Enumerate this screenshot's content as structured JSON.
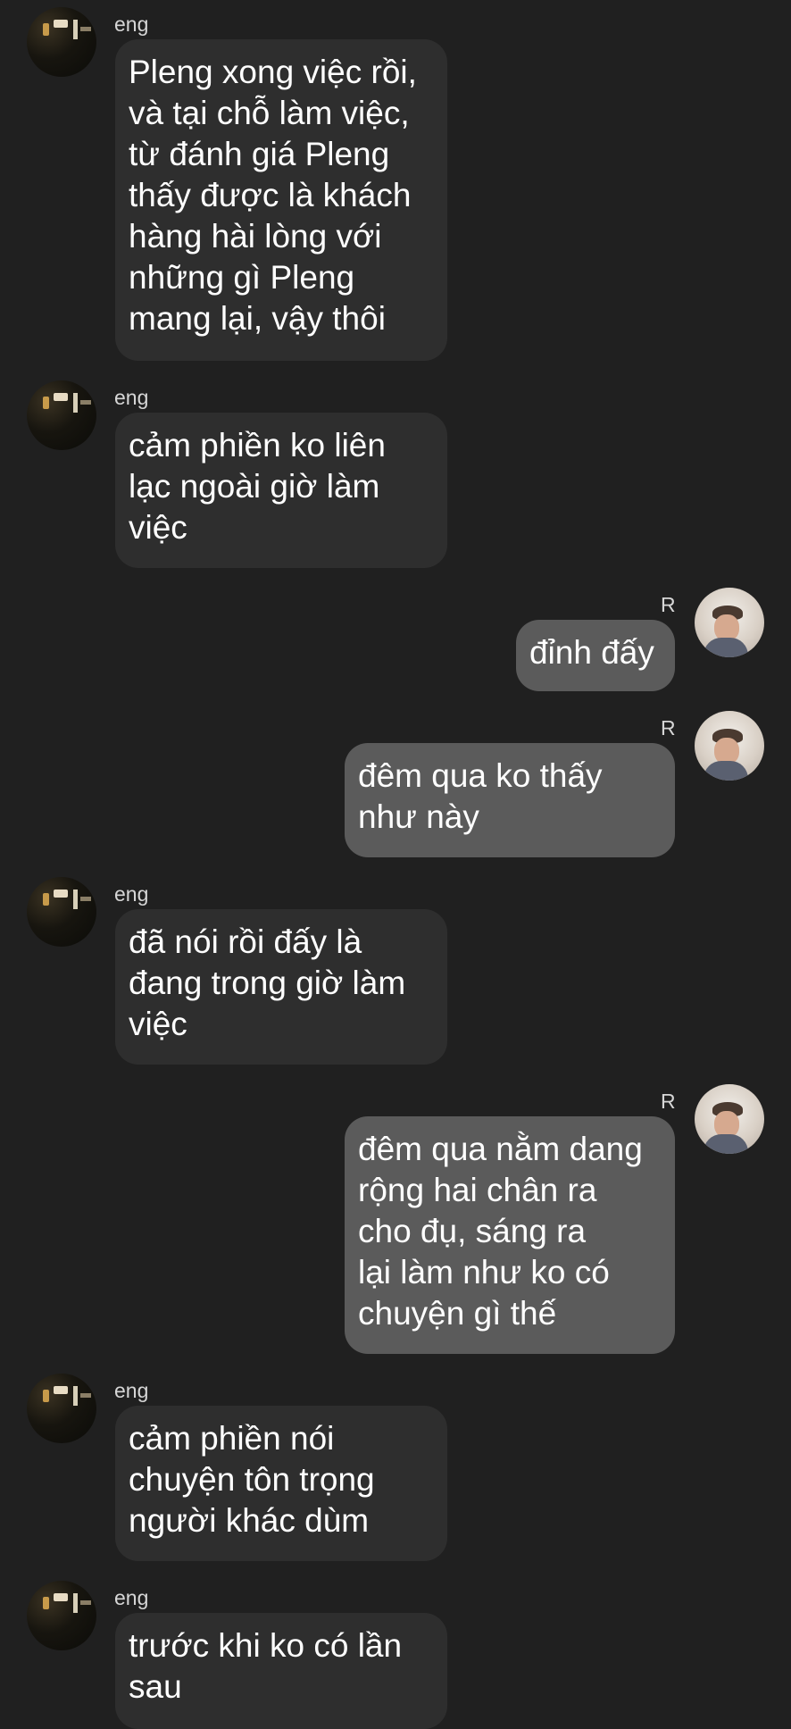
{
  "messages": [
    {
      "sender": "eng",
      "direction": "in",
      "text": "Pleng xong việc rồi,\nvà tại chỗ làm việc,\ntừ đánh giá Pleng\nthấy được là khách\nhàng hài lòng với\nnhững gì Pleng\nmang lại, vậy thôi"
    },
    {
      "sender": "eng",
      "direction": "in",
      "text": "cảm phiền ko liên\nlạc ngoài giờ làm\nviệc"
    },
    {
      "sender": "R",
      "direction": "out",
      "text": "đỉnh đấy"
    },
    {
      "sender": "R",
      "direction": "out",
      "text": "đêm qua ko thấy\nnhư này"
    },
    {
      "sender": "eng",
      "direction": "in",
      "text": "đã nói rồi đấy là\nđang trong giờ làm\nviệc"
    },
    {
      "sender": "R",
      "direction": "out",
      "text": "đêm qua nằm dang\nrộng hai chân ra\ncho đụ, sáng ra\nlại làm như ko có\nchuyện gì thế"
    },
    {
      "sender": "eng",
      "direction": "in",
      "text": "cảm phiền nói\nchuyện tôn trọng\nngười khác dùm"
    },
    {
      "sender": "eng",
      "direction": "in",
      "text": "trước khi ko có lần\nsau"
    }
  ],
  "colors": {
    "background": "#202020",
    "incoming_bubble": "#2e2e2e",
    "outgoing_bubble": "#5b5b5b",
    "text": "#ffffff",
    "sender_name": "#d6d6d6"
  }
}
